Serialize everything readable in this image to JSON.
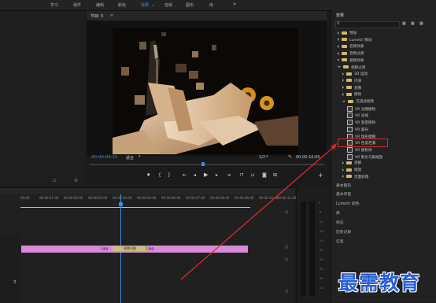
{
  "topbar": {
    "workspaces": [
      "学习",
      "组件",
      "编辑",
      "颜色",
      "效果",
      "音频",
      "图形",
      "库"
    ],
    "active": "效果",
    "more": "»"
  },
  "program": {
    "title": "节目: 5",
    "timecode_current": "00:00:04:21",
    "fit": "适合",
    "quality": "1/2",
    "timecode_end": "00:00:10:00"
  },
  "timeline": {
    "ruler": [
      "00:00",
      "00:00:01:00",
      "00:00:02:00",
      "00:00:03:00",
      "00:00:04:00",
      "00:00:05:00",
      "00:00:06:00",
      "00:00:07:00",
      "00:00:08:00",
      "00:00:09:00",
      "00:00:10:00",
      "00:00:11:00"
    ],
    "clips": [
      "1.jpg",
      "双侧平推",
      "2.jpg"
    ]
  },
  "effects": {
    "title": "效果",
    "search_placeholder": "",
    "tree": [
      {
        "label": "预设",
        "kind": "folder",
        "indent": 0
      },
      {
        "label": "Lumetri 预设",
        "kind": "folder",
        "indent": 0
      },
      {
        "label": "音频效果",
        "kind": "folder",
        "indent": 0
      },
      {
        "label": "音频过渡",
        "kind": "folder",
        "indent": 0
      },
      {
        "label": "视频效果",
        "kind": "folder",
        "indent": 0
      },
      {
        "label": "视频过渡",
        "kind": "folder-open",
        "indent": 0
      },
      {
        "label": "3D 运动",
        "kind": "folder",
        "indent": 1
      },
      {
        "label": "内滑",
        "kind": "folder",
        "indent": 1
      },
      {
        "label": "划像",
        "kind": "folder",
        "indent": 1
      },
      {
        "label": "擦除",
        "kind": "folder",
        "indent": 1
      },
      {
        "label": "沉浸式视频",
        "kind": "folder-open",
        "indent": 1
      },
      {
        "label": "VR 光圈擦除",
        "kind": "fx",
        "indent": 2
      },
      {
        "label": "VR 光线",
        "kind": "fx",
        "indent": 2
      },
      {
        "label": "VR 渐变擦除",
        "kind": "fx",
        "indent": 2
      },
      {
        "label": "VR 漏光",
        "kind": "fx",
        "indent": 2
      },
      {
        "label": "VR 球形模糊",
        "kind": "fx",
        "indent": 2
      },
      {
        "label": "VR 色度泄漏",
        "kind": "fx",
        "indent": 2
      },
      {
        "label": "VR 随机块",
        "kind": "fx",
        "indent": 2
      },
      {
        "label": "VR 默比乌斯缩放",
        "kind": "fx",
        "indent": 2
      },
      {
        "label": "溶解",
        "kind": "folder",
        "indent": 1
      },
      {
        "label": "缩放",
        "kind": "folder",
        "indent": 1
      },
      {
        "label": "页面剥落",
        "kind": "folder",
        "indent": 1
      }
    ]
  },
  "side_panels": [
    "基本图形",
    "基本声音",
    "Lumetri 颜色",
    "库",
    "标记",
    "历史记录",
    "信息"
  ],
  "meter_scale": [
    "0",
    "-6",
    "-12",
    "-18",
    "-24",
    "-30",
    "-36",
    "-42",
    "-48",
    "-54"
  ],
  "watermark": "最需教育",
  "accent": "#3b8ee8",
  "highlight": "#e0262b"
}
